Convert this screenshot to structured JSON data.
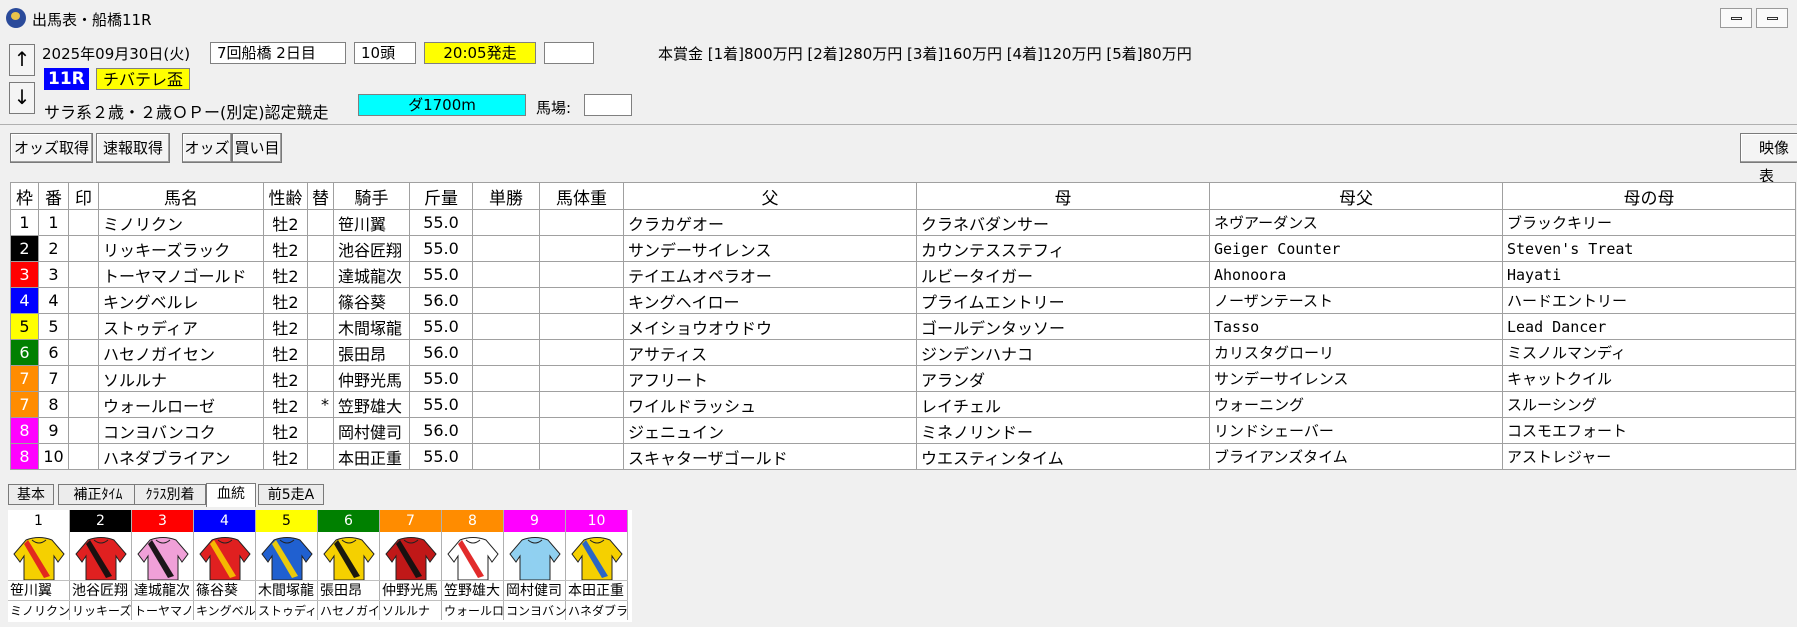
{
  "window": {
    "title": "出馬表・船橋11R"
  },
  "race": {
    "date": "2025年09月30日(火)",
    "meeting": "7回船橋 2日目",
    "runners": "10頭",
    "post_time": "20:05発走",
    "prize": "本賞金 [1着]800万円 [2着]280万円 [3着]160万円 [4着]120万円 [5着]80万円",
    "race_no": "11R",
    "race_name": "チバテレ盃",
    "condition": "サラ系２歳・２歳ＯＰー(別定)認定競走",
    "distance": "ダ1700m",
    "track_label": "馬場:",
    "track_value": ""
  },
  "nav": {
    "up": "↑",
    "down": "↓"
  },
  "toolbar": {
    "odds_fetch": "オッズ取得",
    "quick_fetch": "速報取得",
    "odds": "オッズ",
    "bets": "買い目",
    "video": "映像表"
  },
  "table": {
    "headers": [
      "枠",
      "番",
      "印",
      "馬名",
      "性齢",
      "替",
      "騎手",
      "斤量",
      "単勝",
      "馬体重",
      "父",
      "母",
      "母父",
      "母の母"
    ],
    "rows": [
      {
        "waku": "1",
        "ban": "1",
        "mark": "",
        "name": "ミノリクン",
        "sexage": "牡2",
        "kae": "",
        "jockey": "笹川翼",
        "weight": "55.0",
        "odds": "",
        "bw": "",
        "sire": "クラカゲオー",
        "dam": "クラネバダンサー",
        "damsire": "ネヴアーダンス",
        "damdam": "ブラックキリー"
      },
      {
        "waku": "2",
        "ban": "2",
        "mark": "",
        "name": "リッキーズラック",
        "sexage": "牡2",
        "kae": "",
        "jockey": "池谷匠翔",
        "weight": "55.0",
        "odds": "",
        "bw": "",
        "sire": "サンデーサイレンス",
        "dam": "カウンテスステフィ",
        "damsire": "Geiger Counter",
        "damdam": "Steven's Treat"
      },
      {
        "waku": "3",
        "ban": "3",
        "mark": "",
        "name": "トーヤマノゴールド",
        "sexage": "牡2",
        "kae": "",
        "jockey": "達城龍次",
        "weight": "55.0",
        "odds": "",
        "bw": "",
        "sire": "テイエムオペラオー",
        "dam": "ルビータイガー",
        "damsire": "Ahonoora",
        "damdam": "Hayati"
      },
      {
        "waku": "4",
        "ban": "4",
        "mark": "",
        "name": "キングベルレ",
        "sexage": "牡2",
        "kae": "",
        "jockey": "篠谷葵",
        "weight": "56.0",
        "odds": "",
        "bw": "",
        "sire": "キングヘイロー",
        "dam": "プライムエントリー",
        "damsire": "ノーザンテースト",
        "damdam": "ハードエントリー"
      },
      {
        "waku": "5",
        "ban": "5",
        "mark": "",
        "name": "ストゥディア",
        "sexage": "牡2",
        "kae": "",
        "jockey": "木間塚龍",
        "weight": "55.0",
        "odds": "",
        "bw": "",
        "sire": "メイショウオウドウ",
        "dam": "ゴールデンタッソー",
        "damsire": "Tasso",
        "damdam": "Lead Dancer"
      },
      {
        "waku": "6",
        "ban": "6",
        "mark": "",
        "name": "ハセノガイセン",
        "sexage": "牡2",
        "kae": "",
        "jockey": "張田昂",
        "weight": "56.0",
        "odds": "",
        "bw": "",
        "sire": "アサティス",
        "dam": "ジンデンハナコ",
        "damsire": "カリスタグローリ",
        "damdam": "ミスノルマンディ"
      },
      {
        "waku": "7",
        "ban": "7",
        "mark": "",
        "name": "ソルルナ",
        "sexage": "牡2",
        "kae": "",
        "jockey": "仲野光馬",
        "weight": "55.0",
        "odds": "",
        "bw": "",
        "sire": "アフリート",
        "dam": "アランダ",
        "damsire": "サンデーサイレンス",
        "damdam": "キャットクイル"
      },
      {
        "waku": "7",
        "ban": "8",
        "mark": "",
        "name": "ウォールローゼ",
        "sexage": "牡2",
        "kae": "*",
        "jockey": "笠野雄大",
        "weight": "55.0",
        "odds": "",
        "bw": "",
        "sire": "ワイルドラッシュ",
        "dam": "レイチェル",
        "damsire": "ウォーニング",
        "damdam": "スルーシング"
      },
      {
        "waku": "8",
        "ban": "9",
        "mark": "",
        "name": "コンヨバンコク",
        "sexage": "牡2",
        "kae": "",
        "jockey": "岡村健司",
        "weight": "56.0",
        "odds": "",
        "bw": "",
        "sire": "ジェニュイン",
        "dam": "ミネノリンドー",
        "damsire": "リンドシェーバー",
        "damdam": "コスモエフォート"
      },
      {
        "waku": "8",
        "ban": "10",
        "mark": "",
        "name": "ハネダブライアン",
        "sexage": "牡2",
        "kae": "",
        "jockey": "本田正重",
        "weight": "55.0",
        "odds": "",
        "bw": "",
        "sire": "スキャターザゴールド",
        "dam": "ウエスティンタイム",
        "damsire": "ブライアンズタイム",
        "damdam": "アストレジャー"
      }
    ]
  },
  "waku_colors": {
    "1": {
      "bg": "#ffffff",
      "fg": "#000000"
    },
    "2": {
      "bg": "#000000",
      "fg": "#ffffff"
    },
    "3": {
      "bg": "#ff0000",
      "fg": "#ffffff"
    },
    "4": {
      "bg": "#0000ff",
      "fg": "#ffffff"
    },
    "5": {
      "bg": "#ffff00",
      "fg": "#000000"
    },
    "6": {
      "bg": "#008000",
      "fg": "#ffffff"
    },
    "7": {
      "bg": "#ff8c00",
      "fg": "#ffffff"
    },
    "8": {
      "bg": "#ff00ff",
      "fg": "#ffffff"
    }
  },
  "tabs": [
    "基本",
    "補正ﾀｲﾑ",
    "ｸﾗｽ別着",
    "血統",
    "前5走A"
  ],
  "active_tab": "血統",
  "silks": [
    {
      "num": "1",
      "jockey": "笹川翼",
      "horse": "ミノリクン",
      "base": "#f5d000",
      "band": "#e02020"
    },
    {
      "num": "2",
      "jockey": "池谷匠翔",
      "horse": "リッキーズ",
      "base": "#e02020",
      "band": "#101010"
    },
    {
      "num": "3",
      "jockey": "達城龍次",
      "horse": "トーヤマノ",
      "base": "#f0a0d8",
      "band": "#101010"
    },
    {
      "num": "4",
      "jockey": "篠谷葵",
      "horse": "キングベル",
      "base": "#e02020",
      "band": "#f5c000"
    },
    {
      "num": "5",
      "jockey": "木間塚龍",
      "horse": "ストゥディ",
      "base": "#2060d0",
      "band": "#f5d000"
    },
    {
      "num": "6",
      "jockey": "張田昂",
      "horse": "ハセノガイ",
      "base": "#f5d000",
      "band": "#101010"
    },
    {
      "num": "7",
      "jockey": "仲野光馬",
      "horse": "ソルルナ",
      "base": "#c01818",
      "band": "#101010"
    },
    {
      "num": "8",
      "jockey": "笠野雄大",
      "horse": "ウォールロ",
      "base": "#ffffff",
      "band": "#e02020"
    },
    {
      "num": "9",
      "jockey": "岡村健司",
      "horse": "コンヨバン",
      "base": "#90d0f0",
      "band": "#90d0f0"
    },
    {
      "num": "10",
      "jockey": "本田正重",
      "horse": "ハネダブラ",
      "base": "#f5d000",
      "band": "#2060d0"
    }
  ]
}
